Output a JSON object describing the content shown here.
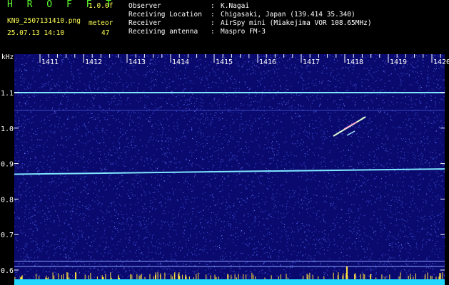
{
  "app": {
    "title": "H R O F F T",
    "version": "1.0.0f",
    "filename": "KN9_2507131410.png",
    "meteor_label": "meteor",
    "timestamp": "25.07.13 14:10",
    "meteor_count": "47"
  },
  "info": [
    {
      "key": "Observer",
      "value": "K.Nagai"
    },
    {
      "key": "Receiving Location",
      "value": "Chigasaki, Japan (139.414 35.340)"
    },
    {
      "key": "Receiver",
      "value": "AirSpy mini (Miakejima VOR 108.65MHz)"
    },
    {
      "key": "Receiving antenna",
      "value": "Maspro FM-3"
    }
  ],
  "spectrogram": {
    "y_unit": "kHz",
    "x_ticks": [
      "1411",
      "1412",
      "1413",
      "1414",
      "1415",
      "1416",
      "1417",
      "1418",
      "1419",
      "1420"
    ],
    "y_ticks": [
      "1.1",
      "1.0",
      "0.9",
      "0.8",
      "0.7",
      "0.6"
    ],
    "colors": {
      "background": "#0a0a6e",
      "noise": "#3a4ad0",
      "trace": "#7fe6ff",
      "echo": "#e0ffcf",
      "bottom_bar": "#22d8ff",
      "spike": "#ffe040"
    }
  }
}
